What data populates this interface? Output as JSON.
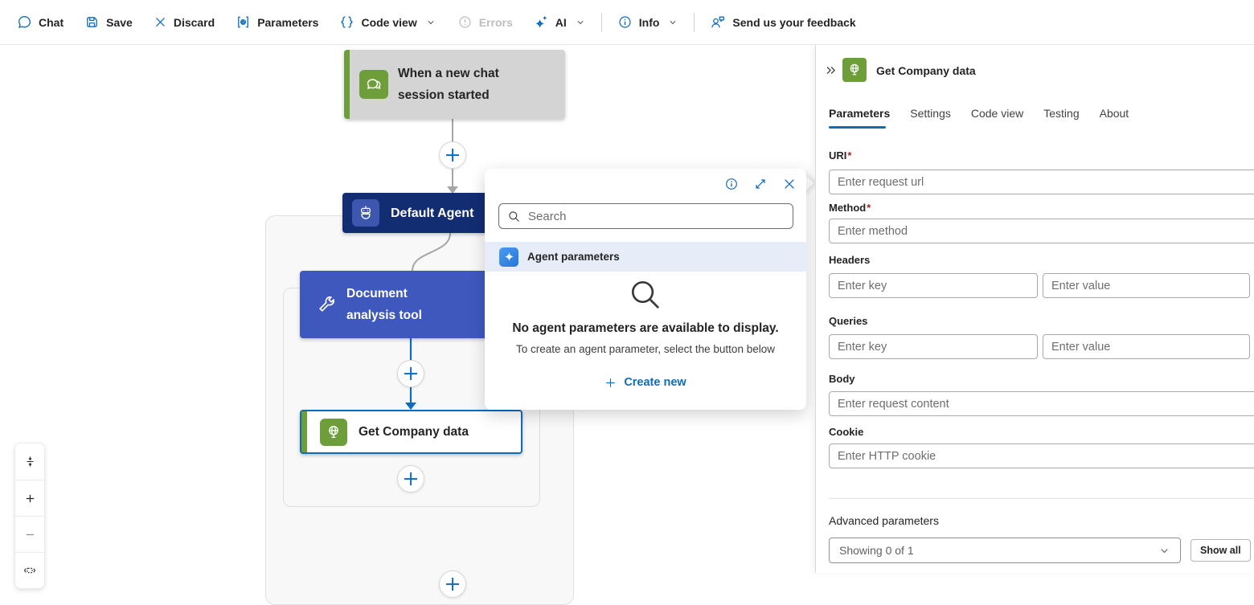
{
  "colors": {
    "accent": "#0f6cbd",
    "navy": "#132d72",
    "royal": "#3e58be",
    "green": "#6d9e3a",
    "node-gray": "#d4d4d4",
    "row-blue": "#e7edf8",
    "ink": "#242424"
  },
  "toolbar": {
    "chat": "Chat",
    "save": "Save",
    "discard": "Discard",
    "parameters": "Parameters",
    "code_view": "Code view",
    "errors": "Errors",
    "ai": "AI",
    "info": "Info",
    "feedback": "Send us your feedback"
  },
  "canvas": {
    "trigger": {
      "line1": "When a new chat",
      "line2": "session started"
    },
    "agent": {
      "title": "Default Agent"
    },
    "tool": {
      "line1": "Document",
      "line2": "analysis tool"
    },
    "action": {
      "title": "Get Company data"
    }
  },
  "popup": {
    "search_placeholder": "Search",
    "section": "Agent parameters",
    "empty_title": "No agent parameters are available to display.",
    "empty_sub": "To create an agent parameter, select the button below",
    "create_new": "Create new"
  },
  "panel": {
    "title": "Get Company data",
    "tabs": [
      "Parameters",
      "Settings",
      "Code view",
      "Testing",
      "About"
    ],
    "active_tab": "Parameters",
    "required_mark": "*",
    "fields": {
      "uri": {
        "label": "URI",
        "placeholder": "Enter request url"
      },
      "method": {
        "label": "Method",
        "placeholder": "Enter method"
      },
      "headers": {
        "label": "Headers",
        "key_placeholder": "Enter key",
        "value_placeholder": "Enter value"
      },
      "queries": {
        "label": "Queries",
        "key_placeholder": "Enter key",
        "value_placeholder": "Enter value"
      },
      "body": {
        "label": "Body",
        "placeholder": "Enter request content"
      },
      "cookie": {
        "label": "Cookie",
        "placeholder": "Enter HTTP cookie"
      }
    },
    "advanced": {
      "label": "Advanced parameters",
      "dropdown_value": "Showing 0 of 1",
      "show_all": "Show all"
    }
  },
  "icons": {
    "chat-icon": "speech-bubble",
    "save-icon": "floppy-disk",
    "discard-icon": "dismiss-x",
    "parameters-icon": "at-sign-brackets",
    "code-view-icon": "curly-braces",
    "errors-icon": "exclamation-circle",
    "ai-icon": "sparkles",
    "info-icon": "info-circle",
    "feedback-icon": "person-feedback",
    "chevron-down-icon": "chevron-down",
    "search-icon": "magnifier",
    "expand-icon": "diagonal-arrows",
    "close-icon": "dismiss-x",
    "agent-parameters-icon": "four-point-star",
    "trigger-icon": "chat-bubbles",
    "agent-icon": "robot",
    "tool-icon": "wrench",
    "http-icon": "globe-on-stand",
    "collapse-icon": "double-chevron-right",
    "fit-view-icon": "arrows-to-line",
    "zoom-in-icon": "plus",
    "zoom-out-icon": "minus",
    "minimap-icon": "boxed-chevrons",
    "insert-icon": "plus-in-circle"
  }
}
